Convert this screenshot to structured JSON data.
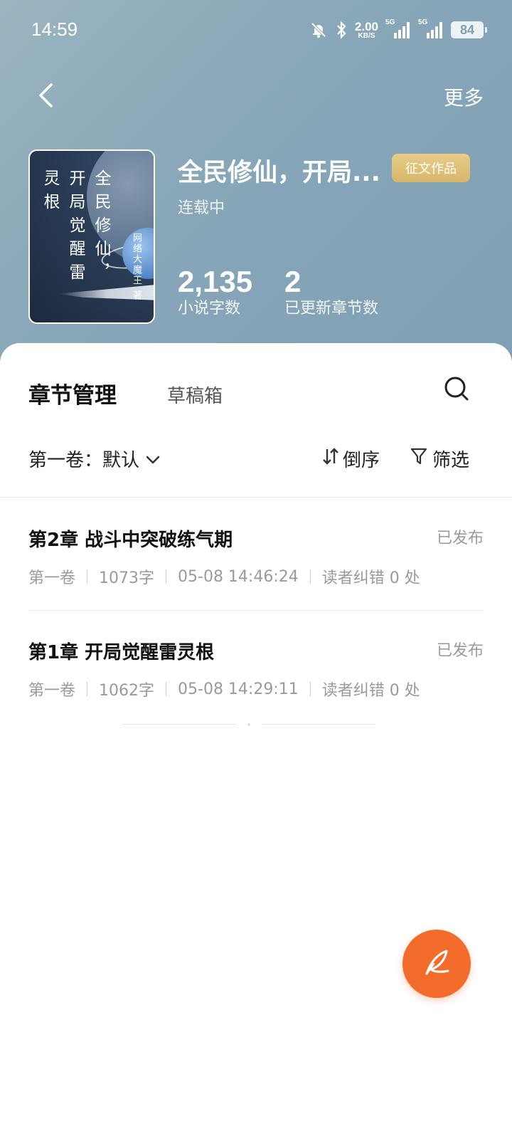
{
  "status_bar": {
    "time": "14:59",
    "net_speed_value": "2.00",
    "net_speed_unit": "KB/S",
    "signal1_label": "5G",
    "signal2_label": "5G",
    "battery": "84"
  },
  "header": {
    "more_label": "更多"
  },
  "book": {
    "cover_title_col1": "灵根",
    "cover_title_col2": "开局觉醒雷",
    "cover_title_col3": "全民修仙，",
    "cover_author": "网络大魔王 著",
    "title": "全民修仙，开局...",
    "badge": "征文作品",
    "status": "连载中",
    "word_count": "2,135",
    "word_count_label": "小说字数",
    "chapter_count": "2",
    "chapter_count_label": "已更新章节数"
  },
  "tabs": {
    "active": "章节管理",
    "draft": "草稿箱"
  },
  "toolbar": {
    "volume": "第一卷：默认",
    "sort": "倒序",
    "filter": "筛选"
  },
  "chapters": [
    {
      "title": "第2章 战斗中突破练气期",
      "state": "已发布",
      "volume": "第一卷",
      "words": "1073字",
      "time": "05-08 14:46:24",
      "errata": "读者纠错 0 处"
    },
    {
      "title": "第1章 开局觉醒雷灵根",
      "state": "已发布",
      "volume": "第一卷",
      "words": "1062字",
      "time": "05-08 14:29:11",
      "errata": "读者纠错 0 处"
    }
  ],
  "colors": {
    "hero_bg": "#87a6b8",
    "badge_bg": "#d8b66a",
    "fab_bg": "#f46c2c",
    "muted_text": "#9a9a9a"
  },
  "icons": {
    "back": "chevron-left-icon",
    "search": "search-icon",
    "volume_dropdown": "chevron-down-icon",
    "sort": "sort-icon",
    "filter": "filter-icon",
    "fab": "quill-pen-icon"
  }
}
